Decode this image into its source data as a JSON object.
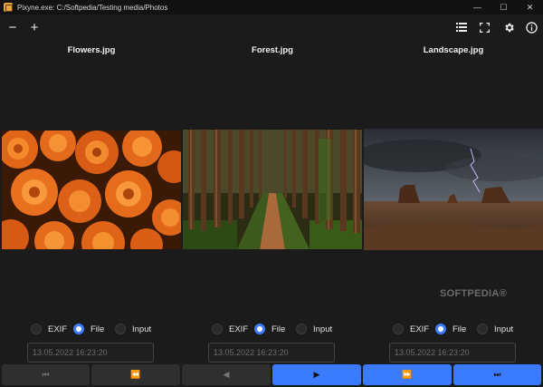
{
  "window": {
    "title": "Pixyne.exe: C:/Softpedia/Testing media/Photos",
    "minimize_glyph": "—",
    "maximize_glyph": "☐",
    "close_glyph": "✕"
  },
  "toolbar": {
    "zoom_out": "−",
    "zoom_in": "+",
    "list_icon": "list-icon",
    "fullscreen_icon": "fullscreen-icon",
    "settings_icon": "gear-icon",
    "info_icon": "info-icon"
  },
  "columns": [
    {
      "filename": "Flowers.jpg",
      "radio_exif": "EXIF",
      "radio_file": "File",
      "radio_input": "Input",
      "selected": "File",
      "date": "13.05.2022 16:23:20"
    },
    {
      "filename": "Forest.jpg",
      "radio_exif": "EXIF",
      "radio_file": "File",
      "radio_input": "Input",
      "selected": "File",
      "date": "13.05.2022 16:23:20"
    },
    {
      "filename": "Landscape.jpg",
      "radio_exif": "EXIF",
      "radio_file": "File",
      "radio_input": "Input",
      "selected": "File",
      "date": "13.05.2022 16:23:20"
    }
  ],
  "nav": {
    "first": "⏮",
    "rewind": "⏪",
    "prev": "◀",
    "next": "▶",
    "fast_forward": "⏩",
    "last": "⏭"
  },
  "watermark": "SOFTPEDIA®",
  "colors": {
    "accent": "#3a7bfd",
    "background": "#1b1b1b",
    "titlebar": "#121212",
    "button_dark": "#2f2f2f"
  }
}
